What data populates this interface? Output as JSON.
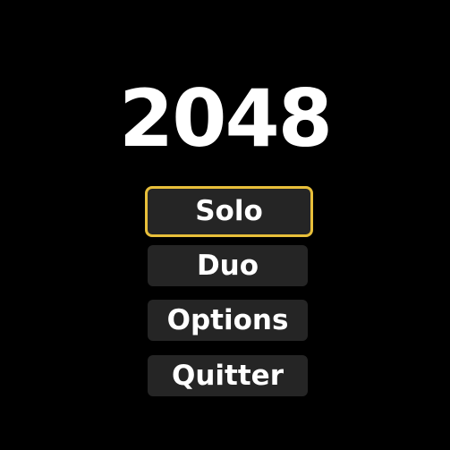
{
  "title": "2048",
  "menu": {
    "items": [
      {
        "label": "Solo",
        "selected": true
      },
      {
        "label": "Duo",
        "selected": false
      },
      {
        "label": "Options",
        "selected": false
      },
      {
        "label": "Quitter",
        "selected": false
      }
    ]
  },
  "colors": {
    "background": "#000000",
    "title_text": "#ffffff",
    "button_background": "#252525",
    "button_text": "#ffffff",
    "selected_border": "#e8bf3a"
  }
}
